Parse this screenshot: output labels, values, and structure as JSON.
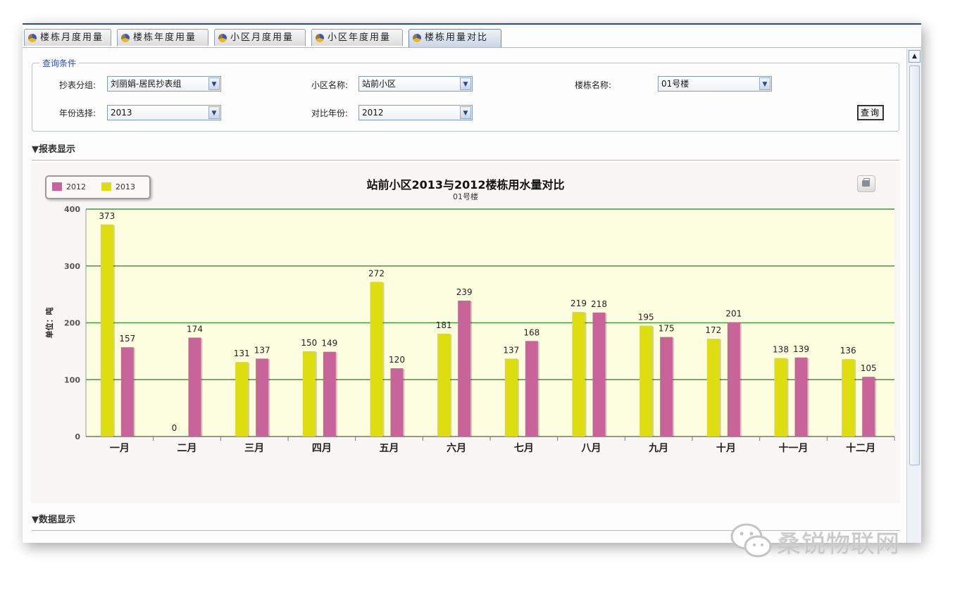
{
  "tabs": [
    {
      "label": "楼栋月度用量"
    },
    {
      "label": "楼栋年度用量"
    },
    {
      "label": "小区月度用量"
    },
    {
      "label": "小区年度用量"
    },
    {
      "label": "楼栋用量对比"
    }
  ],
  "query": {
    "legend": "查询条件",
    "meter_group_label": "抄表分组:",
    "meter_group_value": "刘丽娟-居民抄表组",
    "district_label": "小区名称:",
    "district_value": "站前小区",
    "building_label": "楼栋名称:",
    "building_value": "01号楼",
    "year_label": "年份选择:",
    "year_value": "2013",
    "compare_year_label": "对比年份:",
    "compare_year_value": "2012",
    "search_button": "查询"
  },
  "sections": {
    "report": "▼报表显示",
    "data": "▼数据显示"
  },
  "watermark": "桑锐物联网",
  "colors": {
    "series_2012": "#c9649a",
    "series_2013": "#dddd10",
    "plot_bg": "#fdfde0",
    "grid": "#3d9a3d"
  },
  "chart_data": {
    "type": "bar",
    "title": "站前小区2013与2012楼栋用水量对比",
    "subtitle": "01号楼",
    "ylabel": "单位：吨",
    "ylim": [
      0,
      400
    ],
    "yticks": [
      0,
      100,
      200,
      300,
      400
    ],
    "legend_position": "top-left",
    "categories": [
      "一月",
      "二月",
      "三月",
      "四月",
      "五月",
      "六月",
      "七月",
      "八月",
      "九月",
      "十月",
      "十一月",
      "十二月"
    ],
    "series": [
      {
        "name": "2013",
        "values": [
          373,
          0,
          131,
          150,
          272,
          181,
          137,
          219,
          195,
          172,
          138,
          136
        ]
      },
      {
        "name": "2012",
        "values": [
          157,
          174,
          137,
          149,
          120,
          239,
          168,
          218,
          175,
          201,
          139,
          105
        ]
      }
    ]
  }
}
